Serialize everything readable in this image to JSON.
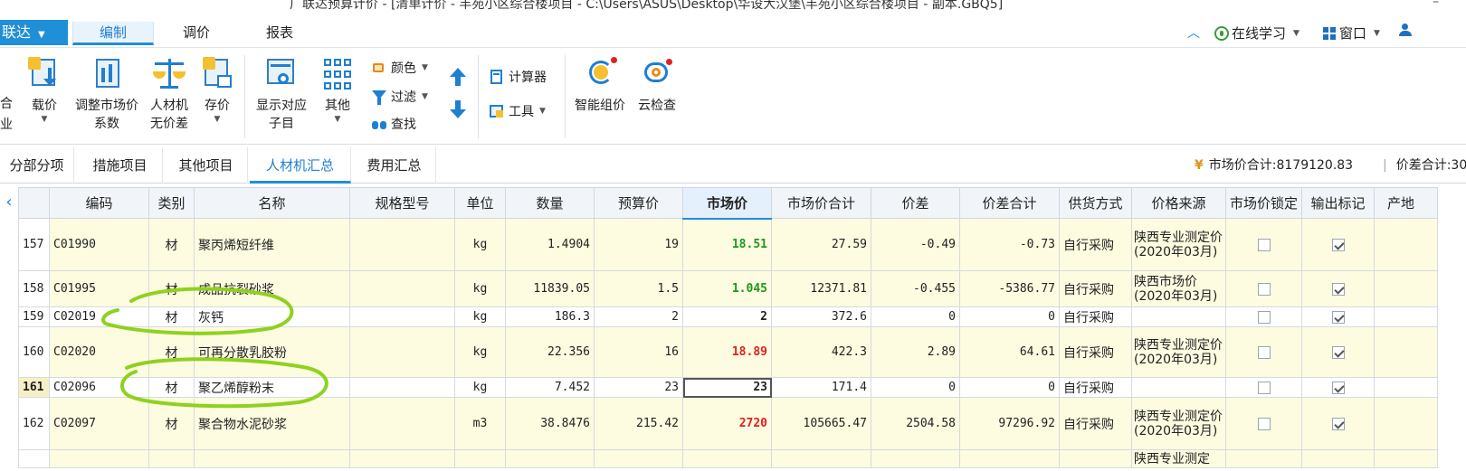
{
  "window": {
    "title": "广联达预算计价 - [清单计价 - 丰苑小区综合楼项目 - C:\\Users\\ASUS\\Desktop\\华设大汉堡\\丰苑小区综合楼项目 - 副本.GBQ5]",
    "minimize": "–"
  },
  "menu": {
    "brand": "联达",
    "tabs": [
      "编制",
      "调价",
      "报表"
    ],
    "active_tab": "编制",
    "right": {
      "online_learning": "在线学习",
      "window": "窗口"
    }
  },
  "ribbon": {
    "left_partial_top": "合",
    "left_partial_bottom": "业",
    "buttons": {
      "zaijia": "载价",
      "adjust_market_1": "调整市场价",
      "adjust_market_2": "系数",
      "rcj_1": "人材机",
      "rcj_2": "无价差",
      "save_price": "存价",
      "show_sub_1": "显示对应",
      "show_sub_2": "子目",
      "other": "其他",
      "color": "颜色",
      "filter": "过滤",
      "find": "查找",
      "calculator": "计算器",
      "tools": "工具",
      "smart_pricing": "智能组价",
      "cloud_check": "云检查"
    }
  },
  "subtabs": {
    "items": [
      "分部分项",
      "措施项目",
      "其他项目",
      "人材机汇总",
      "费用汇总"
    ],
    "active": "人材机汇总",
    "market_total_label": "市场价合计:8179120.83",
    "diff_total_label": "价差合计:30"
  },
  "table": {
    "columns": [
      "编码",
      "类别",
      "名称",
      "规格型号",
      "单位",
      "数量",
      "预算价",
      "市场价",
      "市场价合计",
      "价差",
      "价差合计",
      "供货方式",
      "价格来源",
      "市场价锁定",
      "输出标记",
      "产地"
    ],
    "rows": [
      {
        "no": "157",
        "code": "C01990",
        "type": "材",
        "name": "聚丙烯短纤维",
        "spec": "",
        "unit": "kg",
        "qty": "1.4904",
        "budget": "19",
        "market": "18.51",
        "market_color": "#1a9a1a",
        "market_total": "27.59",
        "diff": "-0.49",
        "diff_total": "-0.73",
        "supply": "自行采购",
        "source": "陕西专业测定价(2020年03月)",
        "lock": false,
        "output": true,
        "yellow": true,
        "current": false
      },
      {
        "no": "158",
        "code": "C01995",
        "type": "材",
        "name": "成品抗裂砂浆",
        "spec": "",
        "unit": "kg",
        "qty": "11839.05",
        "budget": "1.5",
        "market": "1.045",
        "market_color": "#1a9a1a",
        "market_total": "12371.81",
        "diff": "-0.455",
        "diff_total": "-5386.77",
        "supply": "自行采购",
        "source": "陕西市场价(2020年03月)",
        "lock": false,
        "output": true,
        "yellow": true,
        "current": false
      },
      {
        "no": "159",
        "code": "C02019",
        "type": "材",
        "name": "灰钙",
        "spec": "",
        "unit": "kg",
        "qty": "186.3",
        "budget": "2",
        "market": "2",
        "market_color": "#222222",
        "market_total": "372.6",
        "diff": "0",
        "diff_total": "0",
        "supply": "自行采购",
        "source": "",
        "lock": false,
        "output": true,
        "yellow": false,
        "current": false
      },
      {
        "no": "160",
        "code": "C02020",
        "type": "材",
        "name": "可再分散乳胶粉",
        "spec": "",
        "unit": "kg",
        "qty": "22.356",
        "budget": "16",
        "market": "18.89",
        "market_color": "#e02020",
        "market_total": "422.3",
        "diff": "2.89",
        "diff_total": "64.61",
        "supply": "自行采购",
        "source": "陕西专业测定价(2020年03月)",
        "lock": false,
        "output": true,
        "yellow": true,
        "current": false
      },
      {
        "no": "161",
        "code": "C02096",
        "type": "材",
        "name": "聚乙烯醇粉末",
        "spec": "",
        "unit": "kg",
        "qty": "7.452",
        "budget": "23",
        "market": "23",
        "market_color": "#222222",
        "market_total": "171.4",
        "diff": "0",
        "diff_total": "0",
        "supply": "自行采购",
        "source": "",
        "lock": false,
        "output": true,
        "yellow": false,
        "current": true
      },
      {
        "no": "162",
        "code": "C02097",
        "type": "材",
        "name": "聚合物水泥砂浆",
        "spec": "",
        "unit": "m3",
        "qty": "38.8476",
        "budget": "215.42",
        "market": "2720",
        "market_color": "#e02020",
        "market_total": "105665.47",
        "diff": "2504.58",
        "diff_total": "97296.92",
        "supply": "自行采购",
        "source": "陕西专业测定价(2020年03月)",
        "lock": false,
        "output": true,
        "yellow": true,
        "current": false
      },
      {
        "no": "",
        "code": "",
        "type": "",
        "name": "",
        "spec": "",
        "unit": "",
        "qty": "",
        "budget": "",
        "market": "",
        "market_color": "#222222",
        "market_total": "",
        "diff": "",
        "diff_total": "",
        "supply": "",
        "source": "陕西专业测定",
        "lock": false,
        "output": false,
        "yellow": true,
        "current": false
      }
    ]
  },
  "colors": {
    "accent": "#1f8fd8",
    "row_yellow": "#fdfbe0",
    "annotation": "#8fd11f",
    "market_up": "#e02020",
    "market_down": "#1a9a1a"
  }
}
